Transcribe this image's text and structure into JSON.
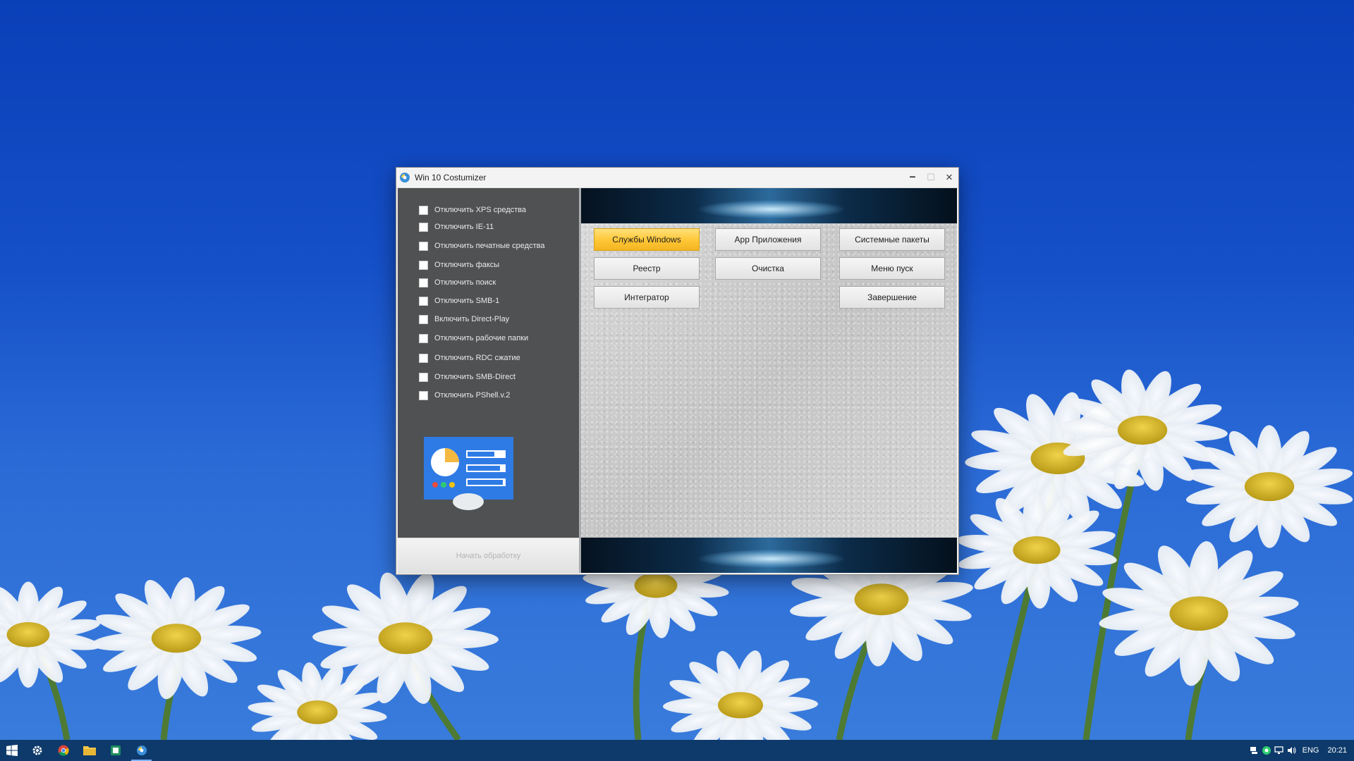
{
  "window": {
    "title": "Win 10 Costumizer",
    "minimize": "🗕",
    "maximize": "☐",
    "close": "✕"
  },
  "options": [
    {
      "label": "Отключить XPS средства",
      "checked": false
    },
    {
      "label": "Отключить IE-11",
      "checked": false
    },
    {
      "label": "Отключить печатные средства",
      "checked": false
    },
    {
      "label": "Отключить факсы",
      "checked": false
    },
    {
      "label": "Отключить поиск",
      "checked": false
    },
    {
      "label": "Отключить SMB-1",
      "checked": false
    },
    {
      "label": "Включить Direct-Play",
      "checked": false
    },
    {
      "label": "Отключить рабочие папки",
      "checked": false
    },
    {
      "label": "Отключить RDC сжатие",
      "checked": false
    },
    {
      "label": "Отключить SMB-Direct",
      "checked": false
    },
    {
      "label": "Отключить PShell.v.2",
      "checked": false
    }
  ],
  "start_button": "Начать обработку",
  "buttons": {
    "services": "Службы Windows",
    "apps": "App Приложения",
    "packages": "Системные пакеты",
    "registry": "Реестр",
    "cleanup": "Очистка",
    "start_menu": "Меню пуск",
    "integrator": "Интегратор",
    "finish": "Завершение"
  },
  "taskbar": {
    "items": [
      "windows-start-icon",
      "settings-icon",
      "chrome-icon",
      "file-explorer-icon",
      "app-icon",
      "customizer-icon"
    ],
    "language": "ENG",
    "clock": "20:21"
  },
  "colors": {
    "active_button": "#ffc635",
    "left_panel": "#4f5153",
    "taskbar": "#0e3a6b"
  }
}
